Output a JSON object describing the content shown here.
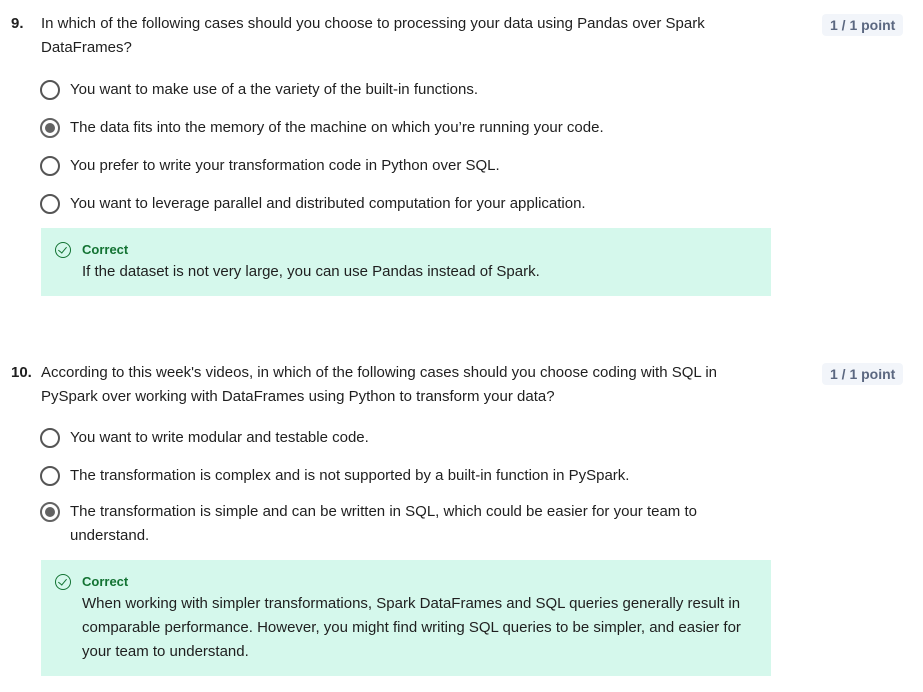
{
  "questions": [
    {
      "number": "9.",
      "text": "In which of the following cases should you choose to processing your data using Pandas over Spark DataFrames?",
      "points": "1 / 1 point",
      "options": [
        {
          "label": "You want to make use of a the variety of the built-in functions.",
          "selected": false
        },
        {
          "label": "The data fits into the memory of the machine on which you’re running your code.",
          "selected": true
        },
        {
          "label": "You prefer to write your transformation code in Python over SQL.",
          "selected": false
        },
        {
          "label": "You want to leverage parallel and distributed computation for your application.",
          "selected": false
        }
      ],
      "feedback": {
        "title": "Correct",
        "text": "If the dataset is not very large, you can use Pandas instead of Spark."
      }
    },
    {
      "number": "10.",
      "text": "According to this week's videos, in which of the following cases should you choose coding with SQL in PySpark over working with DataFrames using Python to transform your data?",
      "points": "1 / 1 point",
      "options": [
        {
          "label": "You want to write modular and testable code.",
          "selected": false
        },
        {
          "label": "The transformation is complex and is not supported by a built-in function in PySpark.",
          "selected": false
        },
        {
          "label": "The transformation is simple and can be written in SQL, which could be easier for your team to understand.",
          "selected": true
        }
      ],
      "feedback": {
        "title": "Correct",
        "text": "When working with simpler transformations, Spark DataFrames and SQL queries generally result in comparable performance. However, you might find writing SQL queries to be simpler, and easier for your team to understand."
      }
    }
  ]
}
